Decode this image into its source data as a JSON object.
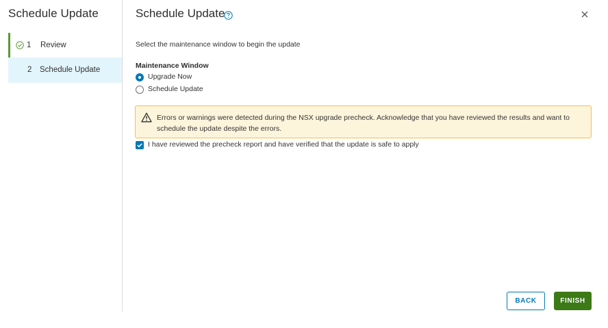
{
  "sidebar": {
    "title": "Schedule Update",
    "steps": [
      {
        "number": "1",
        "label": "Review",
        "status": "completed"
      },
      {
        "number": "2",
        "label": "Schedule Update",
        "status": "active"
      }
    ]
  },
  "header": {
    "title": "Schedule Update"
  },
  "main": {
    "instruction": "Select the maintenance window to begin the update",
    "maintenance_window": {
      "label": "Maintenance Window",
      "options": [
        {
          "label": "Upgrade Now",
          "selected": true
        },
        {
          "label": "Schedule Update",
          "selected": false
        }
      ]
    },
    "alert": {
      "type": "warning",
      "text": "Errors or warnings were detected during the NSX upgrade precheck. Acknowledge that you have reviewed the results and want to schedule the update despite the errors."
    },
    "acknowledge": {
      "label": "I have reviewed the precheck report and have verified that the update is safe to apply",
      "checked": true
    }
  },
  "footer": {
    "back_label": "BACK",
    "finish_label": "FINISH"
  },
  "colors": {
    "accent": "#0079b8",
    "success": "#5a9a2e",
    "finish": "#3c7a17",
    "warning_bg": "#fdf4dc",
    "warning_border": "#f4c04b",
    "active_step_bg": "#e3f5fc"
  }
}
